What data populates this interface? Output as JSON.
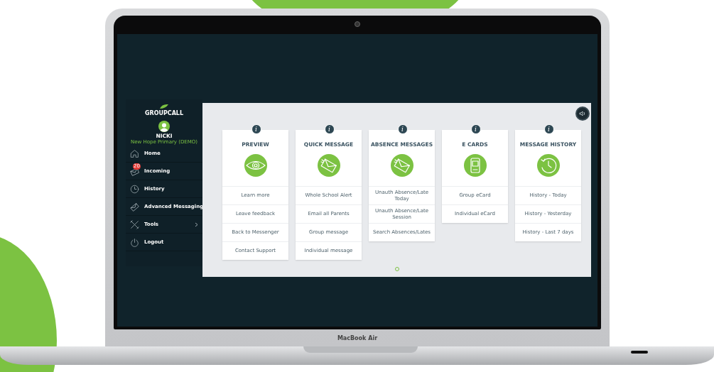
{
  "sidebar": {
    "logo": "GROUPCALL",
    "user": {
      "name": "NICKI",
      "school": "New Hope Primary (DEMO)"
    },
    "items": [
      {
        "label": "Home",
        "kind": "home"
      },
      {
        "label": "Incoming",
        "kind": "incoming",
        "badge": "20"
      },
      {
        "label": "History",
        "kind": "history"
      },
      {
        "label": "Advanced Messaging",
        "kind": "advanced"
      },
      {
        "label": "Tools",
        "kind": "tools",
        "has_submenu": true
      },
      {
        "label": "Logout",
        "kind": "logout"
      }
    ]
  },
  "panels": [
    {
      "title": "PREVIEW",
      "info": "i",
      "kind": "eye",
      "links": [
        "Learn more",
        "Leave feedback",
        "Back to Messenger",
        "Contact Support"
      ]
    },
    {
      "title": "QUICK MESSAGE",
      "info": "i",
      "kind": "envelope",
      "links": [
        "Whole School Alert",
        "Email all Parents",
        "Group message",
        "Individual message"
      ]
    },
    {
      "title": "ABSENCE MESSAGES",
      "info": "i",
      "kind": "envelope",
      "links": [
        "Unauth Absence/Late Today",
        "Unauth Absence/Late Session",
        "Search Absences/Lates"
      ]
    },
    {
      "title": "E CARDS",
      "info": "i",
      "kind": "card",
      "links": [
        "Group eCard",
        "Individual eCard"
      ]
    },
    {
      "title": "MESSAGE HISTORY",
      "info": "i",
      "kind": "history",
      "links": [
        "History - Today",
        "History - Yesterday",
        "History - Last 7 days"
      ]
    }
  ],
  "pager": [
    {
      "selected": true
    }
  ],
  "device_label": "MacBook Air"
}
